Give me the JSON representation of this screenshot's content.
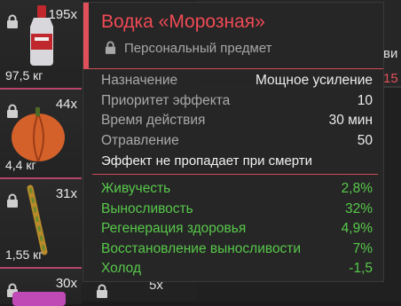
{
  "inventory": [
    {
      "count": "195x",
      "weight": "97,5 кг",
      "icon": "vodka-bottle-icon"
    },
    {
      "count": "44x",
      "weight": "4,4 кг",
      "icon": "pumpkin-icon"
    },
    {
      "count": "31x",
      "weight": "1,55 кг",
      "icon": "stick-item-icon"
    },
    {
      "count": "30x",
      "weight": "",
      "icon": "pink-item-icon"
    }
  ],
  "background": {
    "partial_right_text": "ви",
    "partial_right_number": "15",
    "partial_count": "5x"
  },
  "tooltip": {
    "title": "Водка «Морозная»",
    "subtitle": "Персональный предмет",
    "stats": [
      {
        "label": "Назначение",
        "value": "Мощное усиление"
      },
      {
        "label": "Приоритет эффекта",
        "value": "10"
      },
      {
        "label": "Время действия",
        "value": "30 мин"
      },
      {
        "label": "Отравление",
        "value": "50"
      }
    ],
    "note": "Эффект не пропадает при смерти",
    "effects": [
      {
        "label": "Живучесть",
        "value": "2,8%"
      },
      {
        "label": "Выносливость",
        "value": "32%"
      },
      {
        "label": "Регенерация здоровья",
        "value": "4,9%"
      },
      {
        "label": "Восстановление выносливости",
        "value": "7%"
      },
      {
        "label": "Холод",
        "value": "-1,5"
      }
    ]
  },
  "colors": {
    "accent": "#e0505a",
    "positive": "#57c84a",
    "slot_border": "#b5456b"
  }
}
